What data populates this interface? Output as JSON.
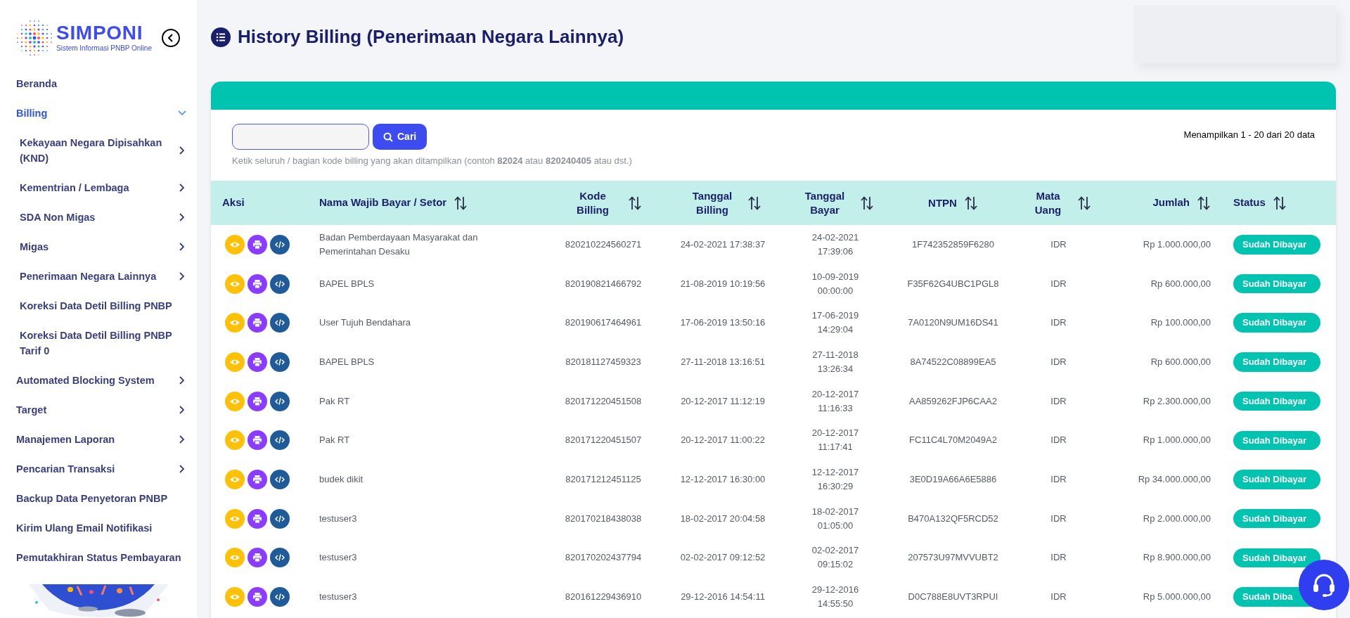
{
  "logo": {
    "name": "SIMPONI",
    "subtitle": "Sistem Informasi PNBP Online"
  },
  "sidebar": {
    "items": [
      {
        "label": "Beranda",
        "submenu": false
      },
      {
        "label": "Billing",
        "submenu": true,
        "expanded": true,
        "children": [
          {
            "label": "Kekayaan Negara Dipisahkan (KND)",
            "submenu": true
          },
          {
            "label": "Kementrian / Lembaga",
            "submenu": true
          },
          {
            "label": "SDA Non Migas",
            "submenu": true
          },
          {
            "label": "Migas",
            "submenu": true
          },
          {
            "label": "Penerimaan Negara Lainnya",
            "submenu": true
          },
          {
            "label": "Koreksi Data Detil Billing PNBP",
            "submenu": false
          },
          {
            "label": "Koreksi Data Detil Billing PNBP Tarif 0",
            "submenu": false
          }
        ]
      },
      {
        "label": "Automated Blocking System",
        "submenu": true,
        "expanded": false
      },
      {
        "label": "Target",
        "submenu": true,
        "expanded": false
      },
      {
        "label": "Manajemen Laporan",
        "submenu": true,
        "expanded": false
      },
      {
        "label": "Pencarian Transaksi",
        "submenu": true,
        "expanded": false
      },
      {
        "label": "Backup Data Penyetoran PNBP",
        "submenu": false
      },
      {
        "label": "Kirim Ulang Email Notifikasi",
        "submenu": false
      },
      {
        "label": "Pemutakhiran Status Pembayaran",
        "submenu": false
      }
    ]
  },
  "page_title": "History Billing (Penerimaan Negara Lainnya)",
  "search": {
    "button": "Cari",
    "hint": "Ketik seluruh / bagian kode billing yang akan ditampilkan (contoh **82024** atau **820240405** atau dst.)"
  },
  "summary": "Menampilkan 1 - 20 dari 20 data",
  "table": {
    "columns": [
      {
        "label": "Aksi",
        "sortable": false
      },
      {
        "label": "Nama Wajib Bayar / Setor",
        "sortable": true
      },
      {
        "label": "Kode Billing",
        "sortable": true
      },
      {
        "label": "Tanggal Billing",
        "sortable": true
      },
      {
        "label": "Tanggal Bayar",
        "sortable": true
      },
      {
        "label": "NTPN",
        "sortable": true
      },
      {
        "label": "Mata Uang",
        "sortable": true
      },
      {
        "label": "Jumlah",
        "sortable": true
      },
      {
        "label": "Status",
        "sortable": true
      }
    ],
    "rows": [
      {
        "name": "Badan Pemberdayaan Masyarakat dan Pemerintahan Desaku",
        "code": "820210224560271",
        "billing_date": "24-02-2021 17:38:37",
        "paid_date": "24-02-2021 17:39:06",
        "ntpn": "1F742352859F6280",
        "currency": "IDR",
        "amount": "Rp 1.000.000,00",
        "status": "Sudah Dibayar"
      },
      {
        "name": "BAPEL BPLS",
        "code": "820190821466792",
        "billing_date": "21-08-2019 10:19:56",
        "paid_date": "10-09-2019 00:00:00",
        "ntpn": "F35F62G4UBC1PGL8",
        "currency": "IDR",
        "amount": "Rp 600.000,00",
        "status": "Sudah Dibayar"
      },
      {
        "name": "User Tujuh Bendahara",
        "code": "820190617464961",
        "billing_date": "17-06-2019 13:50:16",
        "paid_date": "17-06-2019 14:29:04",
        "ntpn": "7A0120N9UM16DS41",
        "currency": "IDR",
        "amount": "Rp 100.000,00",
        "status": "Sudah Dibayar"
      },
      {
        "name": "BAPEL BPLS",
        "code": "820181127459323",
        "billing_date": "27-11-2018 13:16:51",
        "paid_date": "27-11-2018 13:26:34",
        "ntpn": "8A74522C08899EA5",
        "currency": "IDR",
        "amount": "Rp 600.000,00",
        "status": "Sudah Dibayar"
      },
      {
        "name": "Pak RT",
        "code": "820171220451508",
        "billing_date": "20-12-2017 11:12:19",
        "paid_date": "20-12-2017 11:16:33",
        "ntpn": "AA859262FJP6CAA2",
        "currency": "IDR",
        "amount": "Rp 2.300.000,00",
        "status": "Sudah Dibayar"
      },
      {
        "name": "Pak RT",
        "code": "820171220451507",
        "billing_date": "20-12-2017 11:00:22",
        "paid_date": "20-12-2017 11:17:41",
        "ntpn": "FC11C4L70M2049A2",
        "currency": "IDR",
        "amount": "Rp 1.000.000,00",
        "status": "Sudah Dibayar"
      },
      {
        "name": "budek dikit",
        "code": "820171212451125",
        "billing_date": "12-12-2017 16:30:00",
        "paid_date": "12-12-2017 16:30:29",
        "ntpn": "3E0D19A66A6E5886",
        "currency": "IDR",
        "amount": "Rp 34.000.000,00",
        "status": "Sudah Dibayar"
      },
      {
        "name": "testuser3",
        "code": "820170218438038",
        "billing_date": "18-02-2017 20:04:58",
        "paid_date": "18-02-2017 01:05:00",
        "ntpn": "B470A132QF5RCD52",
        "currency": "IDR",
        "amount": "Rp 2.000.000,00",
        "status": "Sudah Dibayar"
      },
      {
        "name": "testuser3",
        "code": "820170202437794",
        "billing_date": "02-02-2017 09:12:52",
        "paid_date": "02-02-2017 09:15:02",
        "ntpn": "207573U97MVVUBT2",
        "currency": "IDR",
        "amount": "Rp 8.900.000,00",
        "status": "Sudah Dibayar"
      },
      {
        "name": "testuser3",
        "code": "820161229436910",
        "billing_date": "29-12-2016 14:54:11",
        "paid_date": "29-12-2016 14:55:50",
        "ntpn": "D0C788E8UVT3RPUI",
        "currency": "IDR",
        "amount": "Rp 5.000.000,00",
        "status": "Sudah Diba"
      }
    ]
  }
}
